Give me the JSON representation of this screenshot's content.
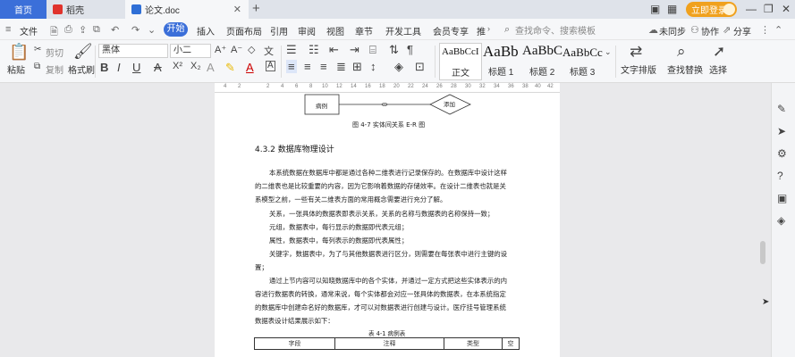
{
  "tabs": {
    "home": "首页",
    "daoke": "稻壳",
    "doc": "论文.doc"
  },
  "window": {
    "login_label": "立即登录",
    "new_tab": "+",
    "minimize": "—",
    "maximize": "❐",
    "close": "✕"
  },
  "menu": {
    "file": "文件",
    "start": "开始",
    "items": [
      "插入",
      "页面布局",
      "引用",
      "审阅",
      "视图",
      "章节",
      "开发工具",
      "会员专享",
      "推"
    ],
    "search_placeholder": "查找命令、搜索模板",
    "unsynced": "未同步",
    "collab": "协作",
    "share": "分享"
  },
  "ribbon": {
    "paste": "粘贴",
    "cut": "剪切",
    "copy": "复制",
    "format_painter": "格式刷",
    "font_name": "黑体",
    "font_size": "小二",
    "styles": [
      {
        "sample": "AaBbCcI",
        "label": "正文"
      },
      {
        "sample": "AaBb",
        "label": "标题 1"
      },
      {
        "sample": "AaBbC",
        "label": "标题 2"
      },
      {
        "sample": "AaBbCc",
        "label": "标题 3"
      }
    ],
    "text_layout": "文字排版",
    "find_replace": "查找替换",
    "select": "选择"
  },
  "ruler": [
    "4",
    "2",
    "2",
    "4",
    "6",
    "8",
    "10",
    "12",
    "14",
    "16",
    "18",
    "20",
    "22",
    "24",
    "26",
    "28",
    "30",
    "32",
    "34",
    "36",
    "38",
    "40",
    "42"
  ],
  "document": {
    "er_entity": "病例",
    "er_diamond": "添加",
    "figure_caption": "图 4-7 实体间关系 E-R 图",
    "heading": "4.3.2  数据库物理设计",
    "paragraphs": [
      "本系统数据在数据库中都是通过各种二维表进行记录保存的。在数据库中设计这样",
      "的二维表也是比较重要的内容，因为它影响着数据的存储效率。在设计二维表也就是关",
      "系模型之前，一些有关二维表方面的常用概念需要进行充分了解。",
      "关系，一张具体的数据表即表示关系，关系的名称与数据表的名称保持一致；",
      "元组，数据表中，每行显示的数据即代表元组；",
      "属性，数据表中，每列表示的数据即代表属性；",
      "关键字，数据表中，为了与其他数据表进行区分，则需要在每张表中进行主键的设",
      "置；",
      "通过上节内容可以知晓数据库中的各个实体，并通过一定方式把这些实体表示的内",
      "容进行数据表的转换，通常来说，每个实体都会对应一张具体的数据表，在本系统指定",
      "的数据库中创建命名好的数据库，才可以对数据表进行创建与设计。医疗挂号管理系统",
      "数据表设计结果展示如下："
    ],
    "table_caption": "表 4-1  病例表",
    "table_headers": [
      "字段",
      "注释",
      "类型",
      "空"
    ]
  },
  "colors": {
    "accent": "#3b6fd9",
    "login": "#f0a11e",
    "daoke_icon": "#e0332c",
    "doc_icon": "#2f6fd6"
  }
}
